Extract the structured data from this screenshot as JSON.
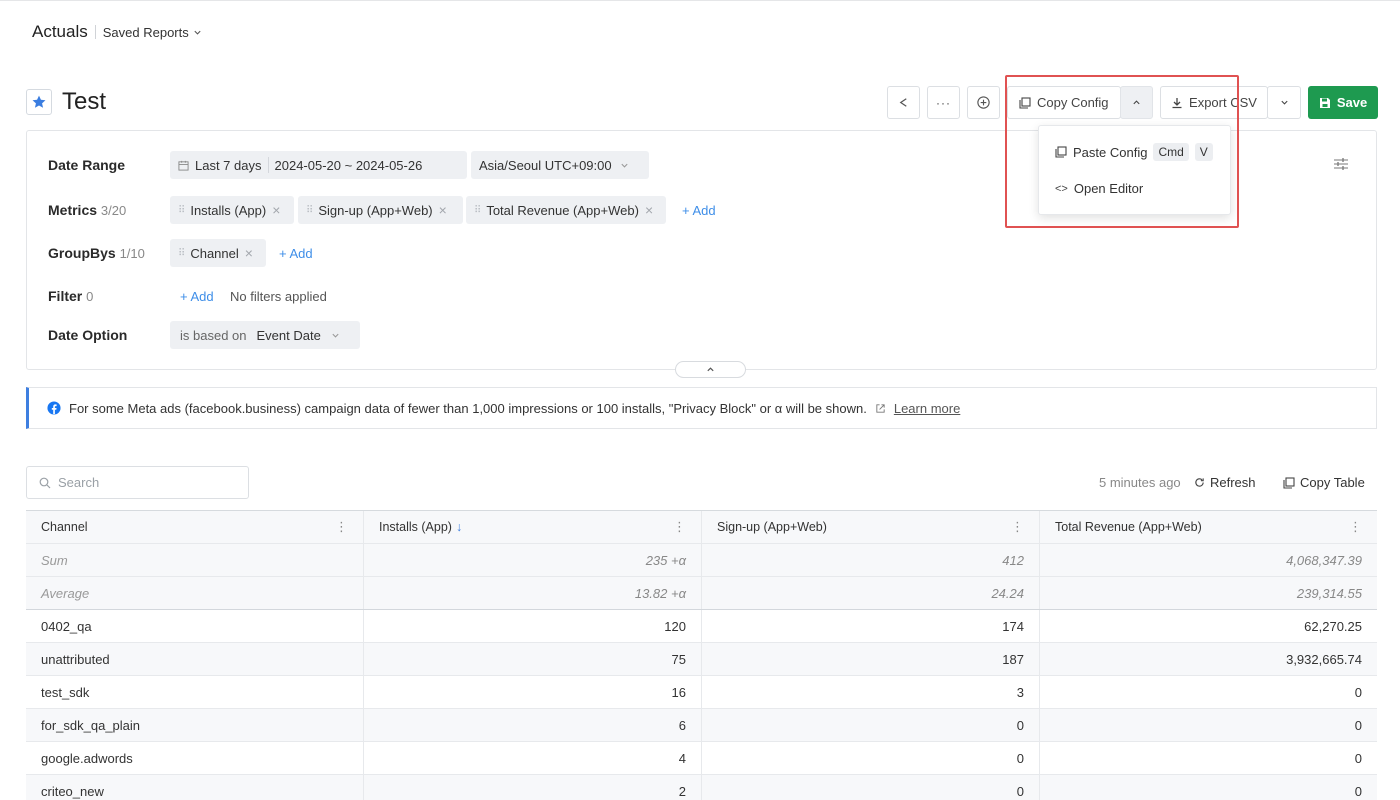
{
  "breadcrumb": {
    "title": "Actuals",
    "saved_reports": "Saved Reports"
  },
  "report": {
    "title": "Test"
  },
  "toolbar": {
    "copy_config": "Copy Config",
    "export_csv": "Export CSV",
    "save": "Save"
  },
  "dropdown": {
    "paste_config": "Paste Config",
    "paste_key1": "Cmd",
    "paste_key2": "V",
    "open_editor": "Open Editor"
  },
  "filters": {
    "date_range_label": "Date Range",
    "date_preset": "Last 7 days",
    "date_range": "2024-05-20 ~ 2024-05-26",
    "timezone": "Asia/Seoul UTC+09:00",
    "metrics_label": "Metrics",
    "metrics_count": "3/20",
    "metrics": [
      "Installs (App)",
      "Sign-up (App+Web)",
      "Total Revenue (App+Web)"
    ],
    "add": "+ Add",
    "groupbys_label": "GroupBys",
    "groupbys_count": "1/10",
    "groupbys": [
      "Channel"
    ],
    "filter_label": "Filter",
    "filter_count": "0",
    "no_filters": "No filters applied",
    "date_option_label": "Date Option",
    "date_option_prefix": "is based on",
    "date_option_value": "Event Date"
  },
  "banner": {
    "text": "For some Meta ads (facebook.business) campaign data of fewer than 1,000 impressions or 100 installs, \"Privacy Block\" or α will be shown.",
    "link": "Learn more"
  },
  "table_tools": {
    "search_placeholder": "Search",
    "updated": "5 minutes ago",
    "refresh": "Refresh",
    "copy_table": "Copy Table"
  },
  "table": {
    "columns": [
      "Channel",
      "Installs (App)",
      "Sign-up (App+Web)",
      "Total Revenue (App+Web)"
    ],
    "aggregates": [
      [
        "Sum",
        "235 +α",
        "412",
        "4,068,347.39"
      ],
      [
        "Average",
        "13.82 +α",
        "24.24",
        "239,314.55"
      ]
    ],
    "rows": [
      [
        "0402_qa",
        "120",
        "174",
        "62,270.25"
      ],
      [
        "unattributed",
        "75",
        "187",
        "3,932,665.74"
      ],
      [
        "test_sdk",
        "16",
        "3",
        "0"
      ],
      [
        "for_sdk_qa_plain",
        "6",
        "0",
        "0"
      ],
      [
        "google.adwords",
        "4",
        "0",
        "0"
      ],
      [
        "criteo_new",
        "2",
        "0",
        "0"
      ]
    ]
  },
  "colors": {
    "accent": "#3e8ee8",
    "save": "#1e9a50",
    "highlight": "#e05252"
  }
}
